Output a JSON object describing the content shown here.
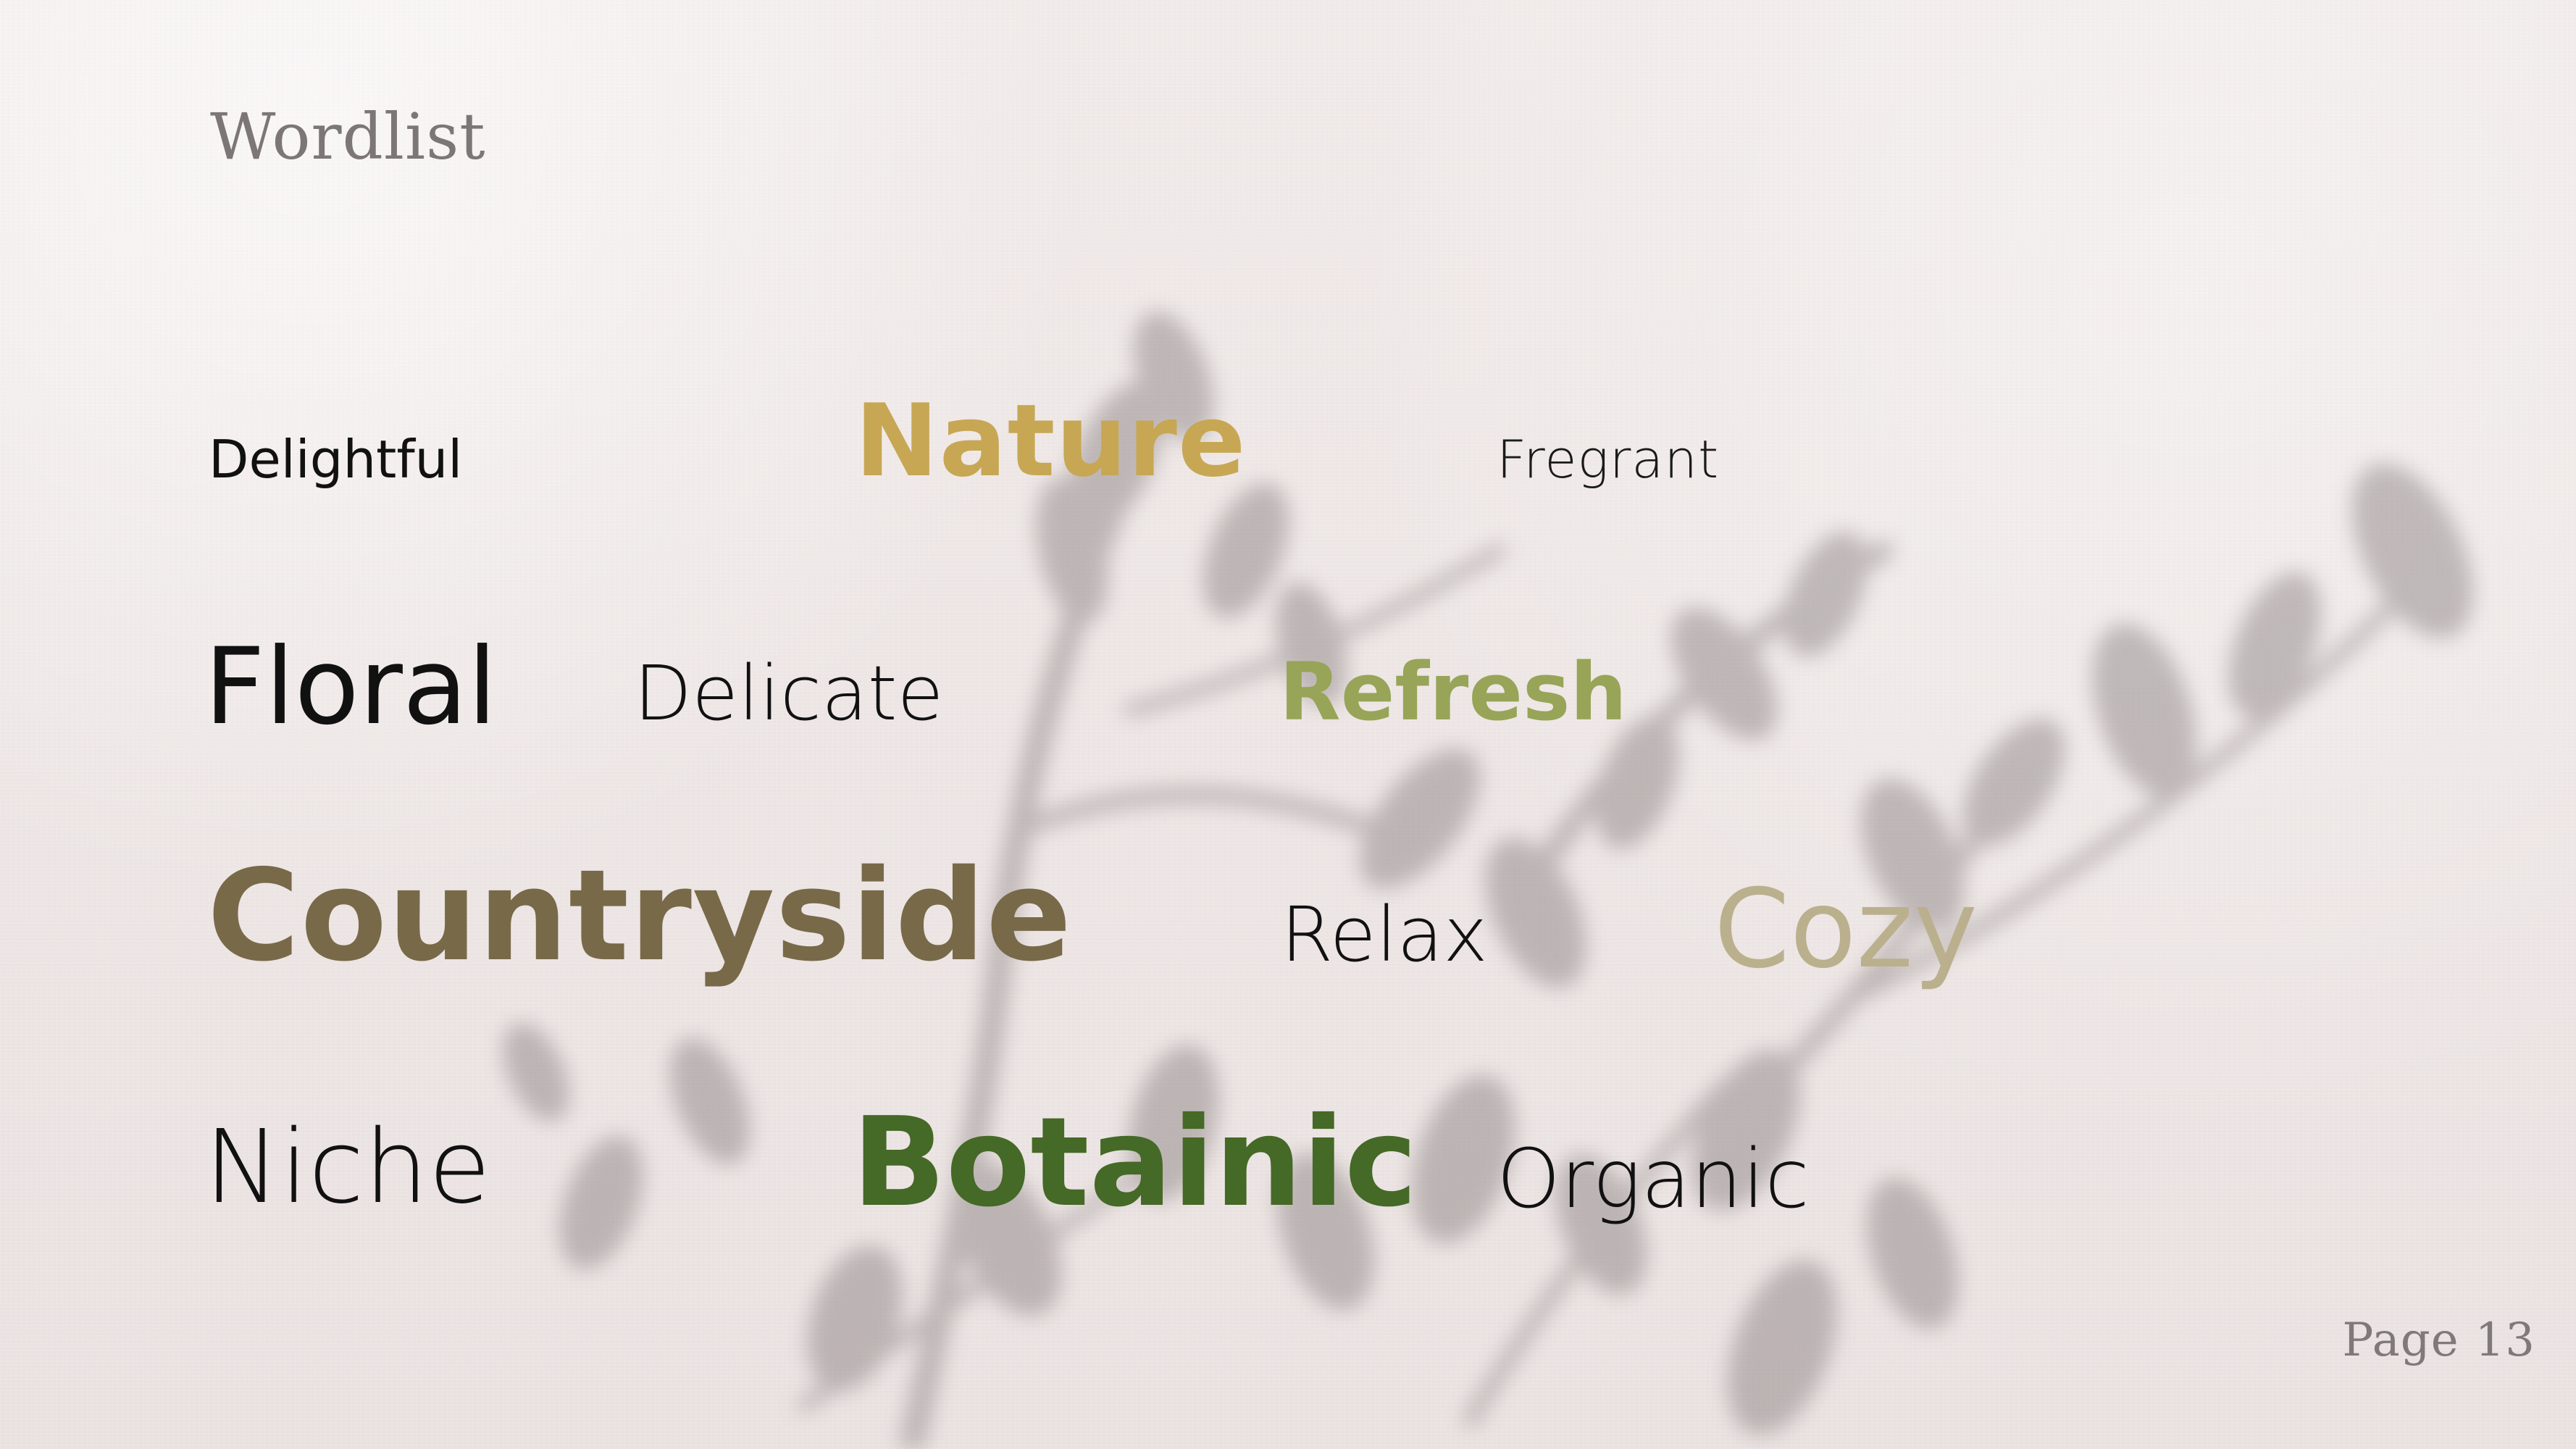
{
  "slide": {
    "title": "Wordlist",
    "page_label": "Page",
    "page_number": "13"
  },
  "words": {
    "delightful": "Delightful",
    "nature": "Nature",
    "fregrant": "Fregrant",
    "floral": "Floral",
    "delicate": "Delicate",
    "refresh": "Refresh",
    "countryside": "Countryside",
    "relax": "Relax",
    "cozy": "Cozy",
    "niche": "Niche",
    "botainic": "Botainic",
    "organic": "Organic"
  },
  "colors": {
    "background": "#efe7e6",
    "title": "#7c7776",
    "nature": "#c7a754",
    "refresh": "#98a457",
    "countryside": "#786948",
    "cozy": "#bbb08d",
    "botainic": "#456926",
    "default_text": "#111111"
  }
}
